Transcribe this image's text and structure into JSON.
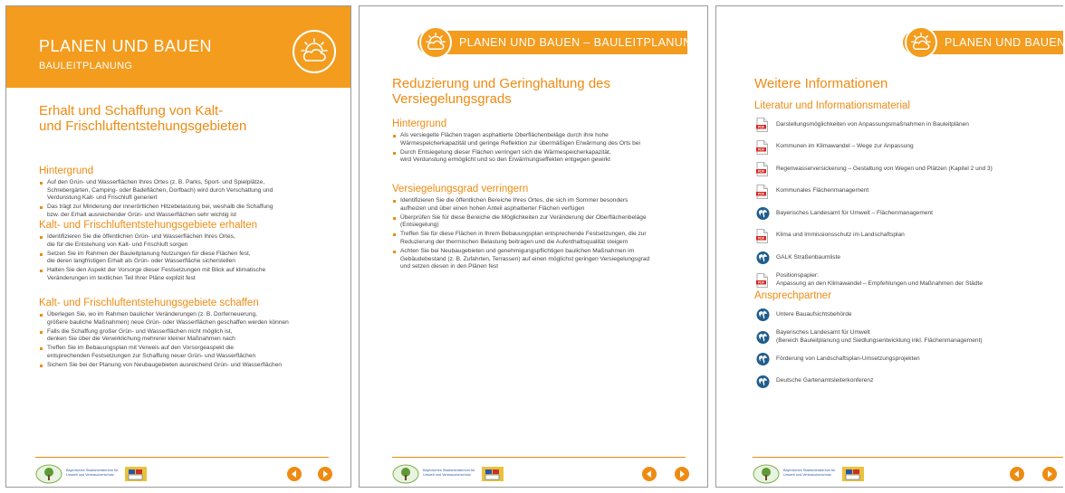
{
  "colors": {
    "accent": "#f39c1e",
    "heading": "#ee8b12"
  },
  "page1": {
    "header_title": "PLANEN UND BAUEN",
    "header_subtitle": "BAULEITPLANUNG",
    "section_title": "Erhalt und Schaffung von Kalt-\nund Frischluftentstehungsgebieten",
    "groups": [
      {
        "heading": "Hintergrund",
        "items": [
          "Auf den Grün- und Wasserflächen Ihres Ortes (z. B. Parks, Sport- und Spielplätze,\nSchrebergärten, Camping- oder Badeflächen, Dorfbach) wird durch Verschattung und\nVerdunstung Kalt- und Frischluft generiert",
          "Das trägt zur Minderung der innerörtlichen Hitzebelastung bei, weshalb die Schaffung\nbzw. der Erhalt ausreichender Grün- und Wasserflächen sehr wichtig ist"
        ]
      },
      {
        "heading": "Kalt- und Frischluftentstehungsgebiete erhalten",
        "items": [
          "Identifizieren Sie die öffentlichen Grün- und Wasserflächen Ihres Ortes,\ndie für die Entstehung von Kalt- und Frischluft sorgen",
          "Setzen Sie im Rahmen der Bauleitplanung Nutzungen für diese Flächen fest,\ndie deren langfristigen Erhalt als Grün- oder Wasserfläche sicherstellen",
          "Halten Sie den Aspekt der Vorsorge dieser Festsetzungen mit Blick auf klimatische\nVeränderungen im textlichen Teil Ihrer Pläne explizit fest"
        ]
      },
      {
        "heading": "Kalt- und Frischluftentstehungsgebiete schaffen",
        "items": [
          "Überlegen Sie, wo im Rahmen baulicher Veränderungen (z. B. Dorferneuerung,\ngrößere bauliche Maßnahmen) neue Grün- oder Wasserflächen geschaffen werden können",
          "Falls die Schaffung großer Grün- und Wasserflächen nicht möglich ist,\ndenken Sie über die Verwirklichung mehrerer kleiner Maßnahmen nach",
          "Treffen Sie im Bebauungsplan mit Verweis auf den Vorsorgeaspekt die\nentsprechenden Festsetzungen zur Schaffung neuer Grün- und Wasserflächen",
          "Sichern Sie bei der Planung von Neubaugebieten ausreichend Grün- und Wasserflächen"
        ]
      }
    ]
  },
  "page2": {
    "header_title": "PLANEN UND BAUEN – BAULEITPLANUNG",
    "section_title": "Reduzierung und Geringhaltung des\nVersiegelungsgrads",
    "groups": [
      {
        "heading": "Hintergrund",
        "items": [
          "Als versiegelte Flächen tragen asphaltierte Oberflächenbeläge durch ihre hohe\nWärmespeicherkapazität und geringe Reflektion zur übermäßigen Erwärmung des Orts bei",
          "Durch Entsiegelung dieser Flächen verringert sich die Wärmespeicherkapazität,\nwird Verdunstung ermöglicht und so den Erwärmungseffekten entgegen gewirkt"
        ]
      },
      {
        "heading": "Versiegelungsgrad verringern",
        "items": [
          "Identifizieren Sie die öffentlichen Bereiche Ihres Ortes, die sich im Sommer besonders\naufheizen und über einen hohen Anteil asphaltierter Flächen verfügen",
          "Überprüfen Sie für diese Bereiche die Möglichkeiten zur Veränderung der Oberflächenbeläge\n(Entsiegelung)",
          "Treffen Sie für diese Flächen in Ihrem Bebauungsplan entsprechende Festsetzungen, die zur\nReduzierung der thermischen Belastung beitragen und die Aufenthaltsqualität steigern",
          "Achten Sie bei Neubaugebieten und genehmigungspflichtigen baulichen Maßnahmen im\nGebäudebestand (z. B. Zufahrten, Terrassen) auf einen möglichst geringen Versiegelungsgrad\nund setzen diesen in den Plänen fest"
        ]
      }
    ]
  },
  "page3": {
    "header_title": "PLANEN UND BAUEN",
    "section_title": "Weitere Informationen",
    "literature_heading": "Literatur und Informationsmaterial",
    "literature": [
      {
        "icon": "pdf-icon",
        "text": "Darstellungsmöglichkeiten von Anpassungsmaßnahmen in Bauleitplänen"
      },
      {
        "icon": "pdf-icon",
        "text": "Kommunen im Klimawandel – Wege zur Anpassung"
      },
      {
        "icon": "pdf-icon",
        "text": "Regenwasserversickerung – Gestaltung von Wegen und Plätzen (Kapitel 2 und 3)"
      },
      {
        "icon": "pdf-icon",
        "text": "Kommunales Flächenmanagement"
      },
      {
        "icon": "globe-icon",
        "text": "Bayerisches Landesamt für Umwelt – Flächenmanagement"
      },
      {
        "icon": "pdf-icon",
        "text": "Klima und Immissionsschutz im Landschaftsplan"
      },
      {
        "icon": "globe-icon",
        "text": "GALK Straßenbaumliste"
      },
      {
        "icon": "pdf-icon",
        "text": "Positionspapier:\nAnpassung an den Klimawandel – Empfehlungen und Maßnahmen der Städte"
      }
    ],
    "contacts_heading": "Ansprechpartner",
    "contacts": [
      {
        "icon": "globe-icon",
        "text": "Untere Bauaufsichtsbehörde"
      },
      {
        "icon": "globe-icon",
        "text": "Bayerisches Landesamt für Umwelt\n(Bereich Bauleitplanung und Siedlungsentwicklung inkl. Flächenmanagement)"
      },
      {
        "icon": "globe-icon",
        "text": "Förderung von Landschaftsplan-Umsetzungsprojekten"
      },
      {
        "icon": "globe-icon",
        "text": "Deutsche Gartenamtsleiterkonferenz"
      }
    ]
  },
  "footer": {
    "ministry": "Bayerisches Staatsministerium für\nUmwelt und Verbraucherschutz",
    "icons": [
      "sun-cloud-logo-icon",
      "tree-logo-icon",
      "state-crest-icon",
      "arrow-left-icon",
      "arrow-right-icon"
    ]
  }
}
